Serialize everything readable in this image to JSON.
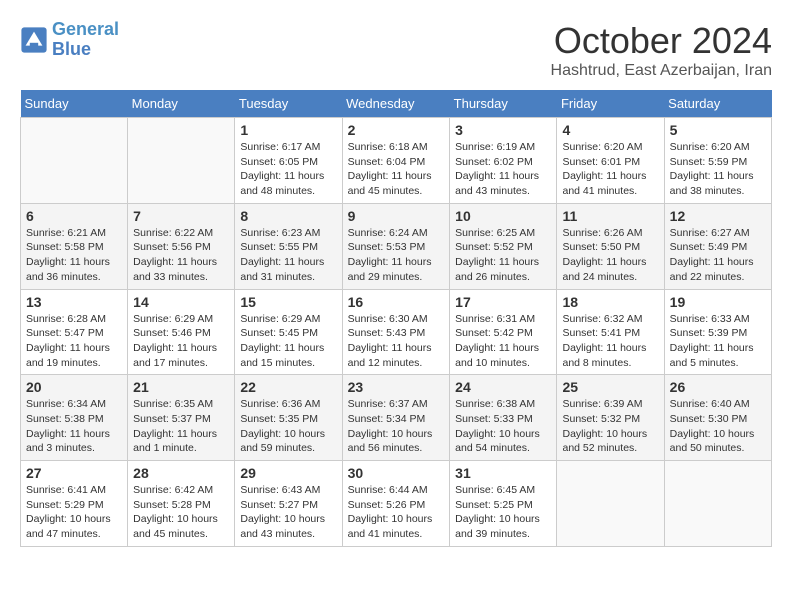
{
  "header": {
    "logo_line1": "General",
    "logo_line2": "Blue",
    "month": "October 2024",
    "location": "Hashtrud, East Azerbaijan, Iran"
  },
  "weekdays": [
    "Sunday",
    "Monday",
    "Tuesday",
    "Wednesday",
    "Thursday",
    "Friday",
    "Saturday"
  ],
  "weeks": [
    [
      {
        "day": "",
        "sunrise": "",
        "sunset": "",
        "daylight": ""
      },
      {
        "day": "",
        "sunrise": "",
        "sunset": "",
        "daylight": ""
      },
      {
        "day": "1",
        "sunrise": "Sunrise: 6:17 AM",
        "sunset": "Sunset: 6:05 PM",
        "daylight": "Daylight: 11 hours and 48 minutes."
      },
      {
        "day": "2",
        "sunrise": "Sunrise: 6:18 AM",
        "sunset": "Sunset: 6:04 PM",
        "daylight": "Daylight: 11 hours and 45 minutes."
      },
      {
        "day": "3",
        "sunrise": "Sunrise: 6:19 AM",
        "sunset": "Sunset: 6:02 PM",
        "daylight": "Daylight: 11 hours and 43 minutes."
      },
      {
        "day": "4",
        "sunrise": "Sunrise: 6:20 AM",
        "sunset": "Sunset: 6:01 PM",
        "daylight": "Daylight: 11 hours and 41 minutes."
      },
      {
        "day": "5",
        "sunrise": "Sunrise: 6:20 AM",
        "sunset": "Sunset: 5:59 PM",
        "daylight": "Daylight: 11 hours and 38 minutes."
      }
    ],
    [
      {
        "day": "6",
        "sunrise": "Sunrise: 6:21 AM",
        "sunset": "Sunset: 5:58 PM",
        "daylight": "Daylight: 11 hours and 36 minutes."
      },
      {
        "day": "7",
        "sunrise": "Sunrise: 6:22 AM",
        "sunset": "Sunset: 5:56 PM",
        "daylight": "Daylight: 11 hours and 33 minutes."
      },
      {
        "day": "8",
        "sunrise": "Sunrise: 6:23 AM",
        "sunset": "Sunset: 5:55 PM",
        "daylight": "Daylight: 11 hours and 31 minutes."
      },
      {
        "day": "9",
        "sunrise": "Sunrise: 6:24 AM",
        "sunset": "Sunset: 5:53 PM",
        "daylight": "Daylight: 11 hours and 29 minutes."
      },
      {
        "day": "10",
        "sunrise": "Sunrise: 6:25 AM",
        "sunset": "Sunset: 5:52 PM",
        "daylight": "Daylight: 11 hours and 26 minutes."
      },
      {
        "day": "11",
        "sunrise": "Sunrise: 6:26 AM",
        "sunset": "Sunset: 5:50 PM",
        "daylight": "Daylight: 11 hours and 24 minutes."
      },
      {
        "day": "12",
        "sunrise": "Sunrise: 6:27 AM",
        "sunset": "Sunset: 5:49 PM",
        "daylight": "Daylight: 11 hours and 22 minutes."
      }
    ],
    [
      {
        "day": "13",
        "sunrise": "Sunrise: 6:28 AM",
        "sunset": "Sunset: 5:47 PM",
        "daylight": "Daylight: 11 hours and 19 minutes."
      },
      {
        "day": "14",
        "sunrise": "Sunrise: 6:29 AM",
        "sunset": "Sunset: 5:46 PM",
        "daylight": "Daylight: 11 hours and 17 minutes."
      },
      {
        "day": "15",
        "sunrise": "Sunrise: 6:29 AM",
        "sunset": "Sunset: 5:45 PM",
        "daylight": "Daylight: 11 hours and 15 minutes."
      },
      {
        "day": "16",
        "sunrise": "Sunrise: 6:30 AM",
        "sunset": "Sunset: 5:43 PM",
        "daylight": "Daylight: 11 hours and 12 minutes."
      },
      {
        "day": "17",
        "sunrise": "Sunrise: 6:31 AM",
        "sunset": "Sunset: 5:42 PM",
        "daylight": "Daylight: 11 hours and 10 minutes."
      },
      {
        "day": "18",
        "sunrise": "Sunrise: 6:32 AM",
        "sunset": "Sunset: 5:41 PM",
        "daylight": "Daylight: 11 hours and 8 minutes."
      },
      {
        "day": "19",
        "sunrise": "Sunrise: 6:33 AM",
        "sunset": "Sunset: 5:39 PM",
        "daylight": "Daylight: 11 hours and 5 minutes."
      }
    ],
    [
      {
        "day": "20",
        "sunrise": "Sunrise: 6:34 AM",
        "sunset": "Sunset: 5:38 PM",
        "daylight": "Daylight: 11 hours and 3 minutes."
      },
      {
        "day": "21",
        "sunrise": "Sunrise: 6:35 AM",
        "sunset": "Sunset: 5:37 PM",
        "daylight": "Daylight: 11 hours and 1 minute."
      },
      {
        "day": "22",
        "sunrise": "Sunrise: 6:36 AM",
        "sunset": "Sunset: 5:35 PM",
        "daylight": "Daylight: 10 hours and 59 minutes."
      },
      {
        "day": "23",
        "sunrise": "Sunrise: 6:37 AM",
        "sunset": "Sunset: 5:34 PM",
        "daylight": "Daylight: 10 hours and 56 minutes."
      },
      {
        "day": "24",
        "sunrise": "Sunrise: 6:38 AM",
        "sunset": "Sunset: 5:33 PM",
        "daylight": "Daylight: 10 hours and 54 minutes."
      },
      {
        "day": "25",
        "sunrise": "Sunrise: 6:39 AM",
        "sunset": "Sunset: 5:32 PM",
        "daylight": "Daylight: 10 hours and 52 minutes."
      },
      {
        "day": "26",
        "sunrise": "Sunrise: 6:40 AM",
        "sunset": "Sunset: 5:30 PM",
        "daylight": "Daylight: 10 hours and 50 minutes."
      }
    ],
    [
      {
        "day": "27",
        "sunrise": "Sunrise: 6:41 AM",
        "sunset": "Sunset: 5:29 PM",
        "daylight": "Daylight: 10 hours and 47 minutes."
      },
      {
        "day": "28",
        "sunrise": "Sunrise: 6:42 AM",
        "sunset": "Sunset: 5:28 PM",
        "daylight": "Daylight: 10 hours and 45 minutes."
      },
      {
        "day": "29",
        "sunrise": "Sunrise: 6:43 AM",
        "sunset": "Sunset: 5:27 PM",
        "daylight": "Daylight: 10 hours and 43 minutes."
      },
      {
        "day": "30",
        "sunrise": "Sunrise: 6:44 AM",
        "sunset": "Sunset: 5:26 PM",
        "daylight": "Daylight: 10 hours and 41 minutes."
      },
      {
        "day": "31",
        "sunrise": "Sunrise: 6:45 AM",
        "sunset": "Sunset: 5:25 PM",
        "daylight": "Daylight: 10 hours and 39 minutes."
      },
      {
        "day": "",
        "sunrise": "",
        "sunset": "",
        "daylight": ""
      },
      {
        "day": "",
        "sunrise": "",
        "sunset": "",
        "daylight": ""
      }
    ]
  ]
}
